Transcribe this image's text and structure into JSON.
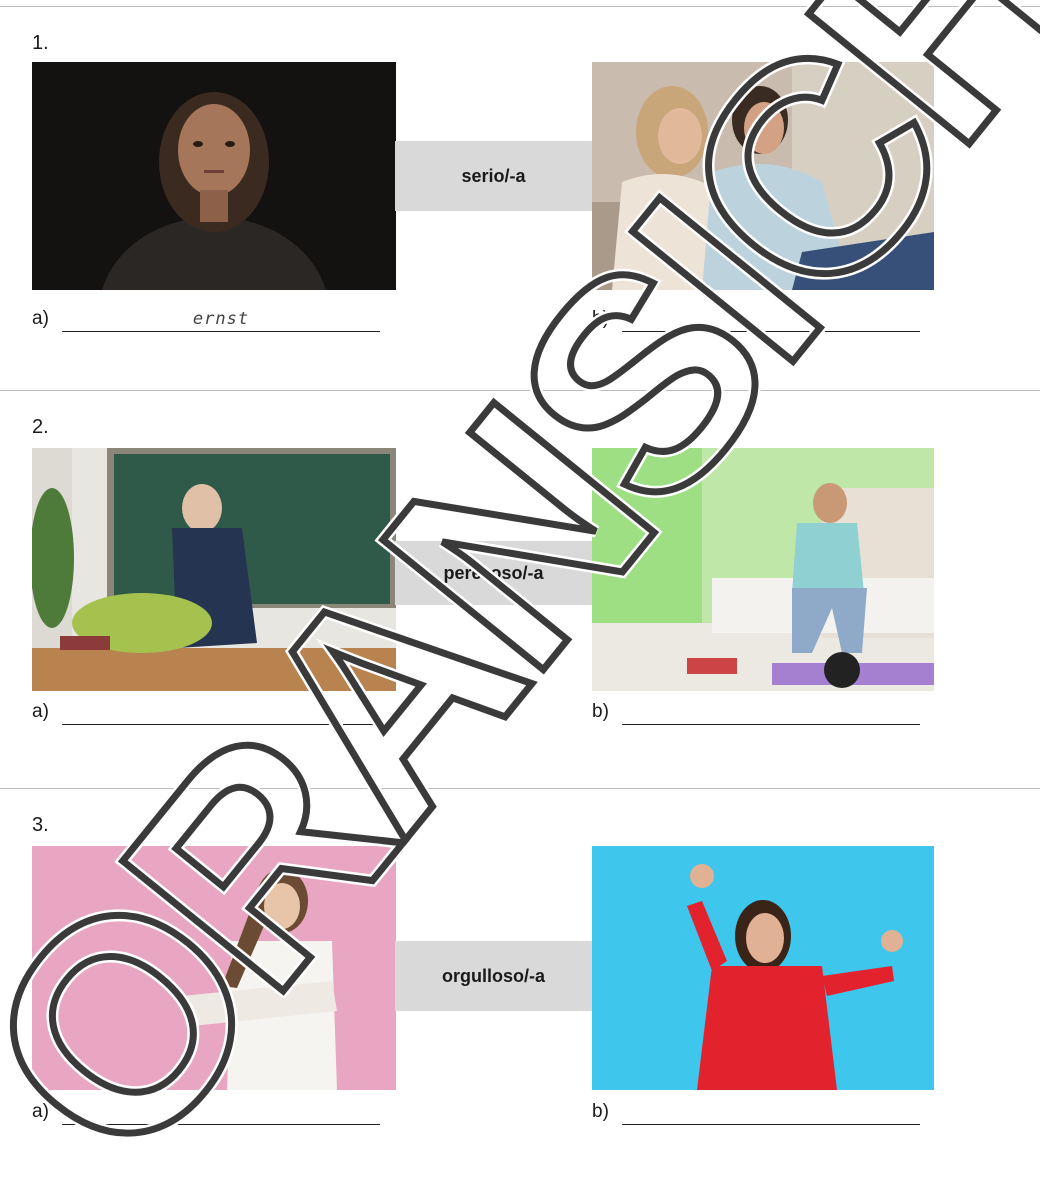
{
  "rows": [
    {
      "number": "1.",
      "term": "serio/-a",
      "answer_a_label": "a)",
      "answer_a_value": "ernst",
      "answer_b_label": "b)",
      "answer_b_value": ""
    },
    {
      "number": "2.",
      "term": "perezoso/-a",
      "answer_a_label": "a)",
      "answer_a_value": "",
      "answer_b_label": "b)",
      "answer_b_value": ""
    },
    {
      "number": "3.",
      "term": "orgulloso/-a",
      "answer_a_label": "a)",
      "answer_a_value": "",
      "answer_b_label": "b)",
      "answer_b_value": ""
    }
  ],
  "watermark_text": "ORANSICHT",
  "colors": {
    "term_box": "#d9d9d9",
    "divider": "#bdbdbd",
    "watermark": "#3a3a3a"
  }
}
